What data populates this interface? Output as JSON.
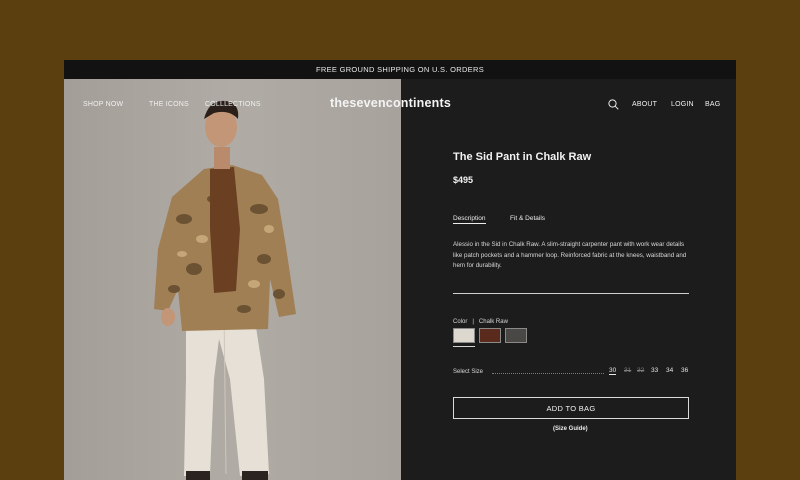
{
  "promo": "FREE GROUND SHIPPING ON U.S. ORDERS",
  "nav": {
    "left": [
      "SHOP NOW",
      "THE ICONS",
      "COLLLECTIONS"
    ],
    "logo": "thesevencontinents",
    "right": [
      "ABOUT",
      "LOGIN",
      "BAG"
    ]
  },
  "product": {
    "title": "The Sid Pant in Chalk Raw",
    "price": "$495",
    "tabs": [
      "Description",
      "Fit & Details"
    ],
    "description": "Alessio in the Sid in Chalk Raw. A slim-straight carpenter pant with work wear details like patch pockets and a hammer loop. Reinforced fabric at the knees, waistband and hem for durability.",
    "color_label": "Color",
    "color_value": "Chalk Raw",
    "swatches": [
      "#dcd7cf",
      "#5a2a1c",
      "#4a4845"
    ],
    "size_label": "Select Size",
    "sizes": [
      "30",
      "31",
      "32",
      "33",
      "34",
      "36"
    ],
    "selected_size": "30",
    "unavailable_sizes": [
      "31",
      "32"
    ],
    "add_to_bag": "ADD TO BAG",
    "size_guide": "(Size Guide)"
  }
}
